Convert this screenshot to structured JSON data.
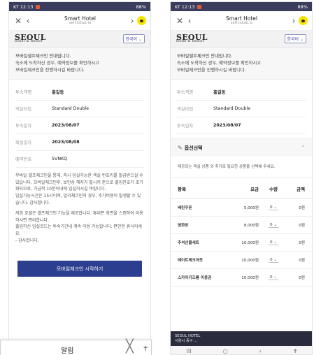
{
  "left": {
    "status": {
      "time": "KT 12:13",
      "right": "88%"
    },
    "browser": {
      "back": "✕",
      "prev": "‹",
      "title": "Smart Hotel",
      "url": "self.tstab.io",
      "next": "›"
    },
    "brand": {
      "logo_main": "SEOUL",
      "logo_sub": "Hotel & Resort",
      "lang": "한국어 ⌄"
    },
    "notice": {
      "line1": "모바일셀프체크인 안내입니다.",
      "line2": "숙소에 도착하신 경우, 예약정보를 확인하시고",
      "line3": "모바일체크인을 진행하시길 바랍니다."
    },
    "info": [
      {
        "key": "투숙객명",
        "value": "홍길동"
      },
      {
        "key": "객실타입",
        "value": "Standard Double"
      },
      {
        "key": "투숙일자",
        "value": "2023/08/07"
      },
      {
        "key": "퇴실일자",
        "value": "2023/08/08"
      },
      {
        "key": "예약번호",
        "value": "5VNKQ"
      }
    ],
    "longtext": {
      "p1": "무바일 셀프체크인을 통해, 즉시 입실가능한 객실 번호키를 발급받으실 수 있습니다. 모바일체크인후, 보안상 해지가 필시키 준으로 출입인호가 초기화되므로, 가급적 10분이내에 입실하시길 바랍니다.",
      "p2": "입실가능시간은 15시이며, 얼리체크인의 경우, 추가비용이 발생할 수 있습니다. 감사합니다.",
      "p3": "저희 호텔은 셀프체크인 기능을 제공합니다. 휴대폰 화면을 스캔하여 이용하시면 편리합니다.",
      "p4": "출입하신 입실코드는 투숙기간내 계속 이용 가능합니다. 편안한 휴식되세요.",
      "p5": "- 감사합니다."
    },
    "start_button": "모바일체크인 시작하기",
    "alert": {
      "title": "알림",
      "close": "╳",
      "accessibility": "✝"
    }
  },
  "right": {
    "status": {
      "time": "KT 12:13",
      "right": "88%"
    },
    "browser": {
      "back": "✕",
      "prev": "‹",
      "title": "Smart Hotel",
      "url": "self.tstab.io",
      "next": "›"
    },
    "brand": {
      "logo_main": "SEOUL",
      "logo_sub": "Hotel & Resort",
      "lang": "한국어 ⌄"
    },
    "notice": {
      "line1": "모바일셀프체크인 안내입니다.",
      "line2": "숙소에 도착하신 경우, 예약정보를 확인하시고",
      "line3": "모바일체크인을 진행하시길 바랍니다."
    },
    "info": [
      {
        "key": "투숙객명",
        "value": "홍길동"
      },
      {
        "key": "객실타입",
        "value": "Standard Double"
      },
      {
        "key": "투숙일자",
        "value": "2023/08/07"
      }
    ],
    "options": {
      "title": "옵션선택",
      "pen": "✎",
      "chevron": "^",
      "description": "제공되는 객실 상품 외 추가로 필요한 상품을 선택해 주세요.",
      "headers": {
        "name": "항목",
        "price": "요금",
        "qty": "수량",
        "total": "금액"
      },
      "rows": [
        {
          "name": "베린쿠폰",
          "price": "5,000원",
          "qty": "0 ⌄",
          "total": "0원"
        },
        {
          "name": "영화표",
          "price": "8,000원",
          "qty": "0 ⌄",
          "total": "0원"
        },
        {
          "name": "추석선물세트",
          "price": "10,000원",
          "qty": "0 ⌄",
          "total": "0원"
        },
        {
          "name": "레이트체크아웃",
          "price": "10,000원",
          "qty": "0 ⌄",
          "total": "0원"
        },
        {
          "name": "스카이키즈룸 이용권",
          "price": "10,000원",
          "qty": "0 ⌄",
          "total": "0원"
        }
      ]
    },
    "footer": {
      "line1": "SEOUL HOTEL",
      "line2": "서울시 중구 ..."
    },
    "nav": {
      "recent": "III",
      "home": "○",
      "back": "‹",
      "access": "✝"
    }
  }
}
